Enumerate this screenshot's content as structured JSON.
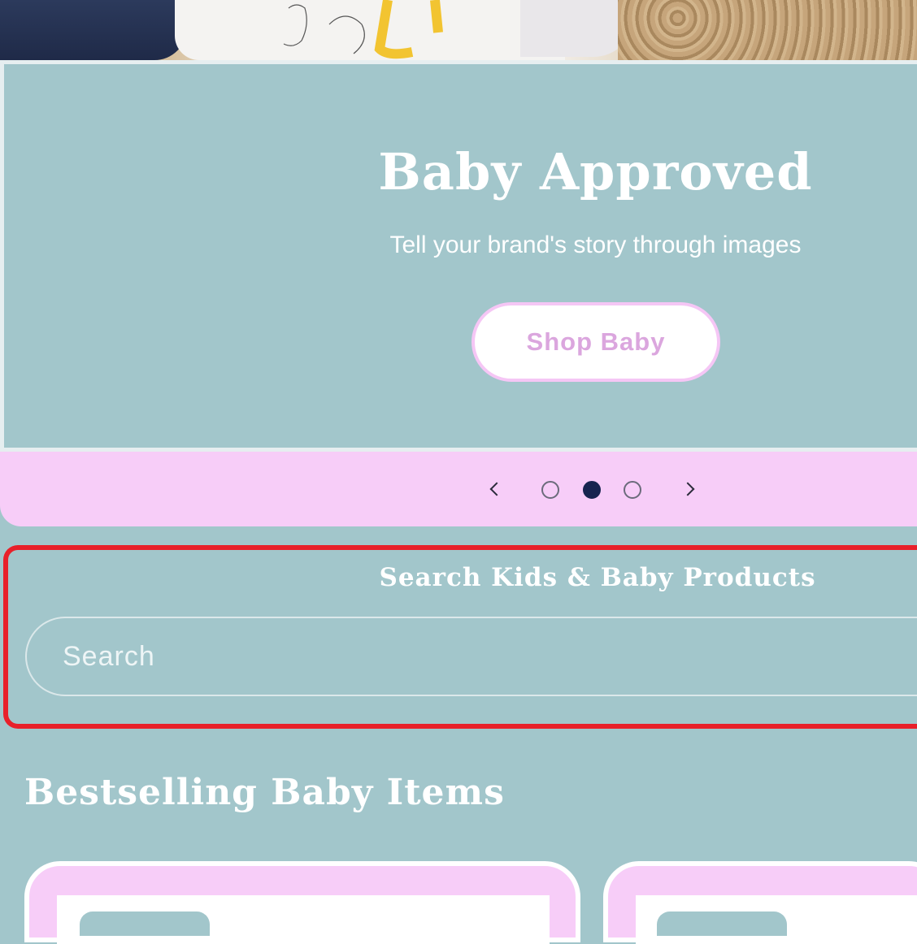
{
  "slide": {
    "title": "Baby Approved",
    "subtitle": "Tell your brand's story through images",
    "button_label": "Shop Baby"
  },
  "slider": {
    "slide_count": 3,
    "active_slide": 2
  },
  "search": {
    "heading": "Search Kids & Baby Products",
    "placeholder": "Search"
  },
  "bestselling": {
    "title": "Bestselling Baby Items"
  },
  "colors": {
    "page_background": "#a2c6cb",
    "slider_bar": "#f7cdf8",
    "button_text": "#dba6de",
    "active_dot": "#17244f",
    "highlight_border": "#e8202a"
  },
  "icons": {
    "prev": "chevron-left-icon",
    "next": "chevron-right-icon"
  }
}
